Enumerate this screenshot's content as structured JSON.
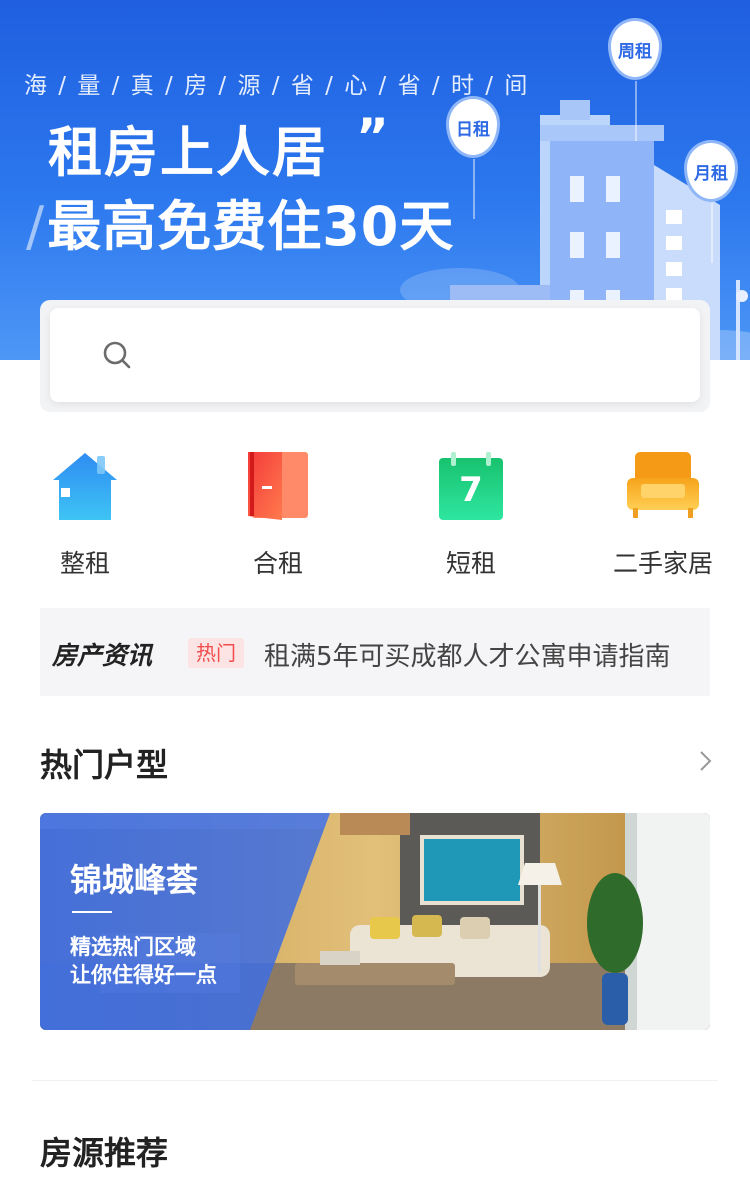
{
  "hero": {
    "tagline": "海 / 量 / 真 / 房 / 源 / 省 / 心 / 省 / 时 / 间",
    "line1": "租房上人居",
    "quote": "”",
    "slash": "/",
    "line2": "最高免费住30天",
    "balloons": [
      "周租",
      "日租",
      "月租"
    ]
  },
  "search": {
    "placeholder": ""
  },
  "categories": [
    {
      "label": "整租",
      "icon": "house-icon"
    },
    {
      "label": "合租",
      "icon": "door-icon"
    },
    {
      "label": "短租",
      "icon": "calendar-icon",
      "calendar_number": "7"
    },
    {
      "label": "二手家居",
      "icon": "sofa-icon"
    }
  ],
  "news": {
    "title": "房产资讯",
    "badge": "热门",
    "text": "租满5年可买成都人才公寓申请指南"
  },
  "sections": {
    "hot_layouts": "热门户型",
    "recommend": "房源推荐"
  },
  "promo": {
    "title": "锦城峰荟",
    "subtitle1": "精选热门区域",
    "subtitle2": "让你住得好一点"
  },
  "colors": {
    "brand_blue": "#2c78ee",
    "badge_red": "#f24d4d",
    "badge_bg": "#fde4e4"
  }
}
